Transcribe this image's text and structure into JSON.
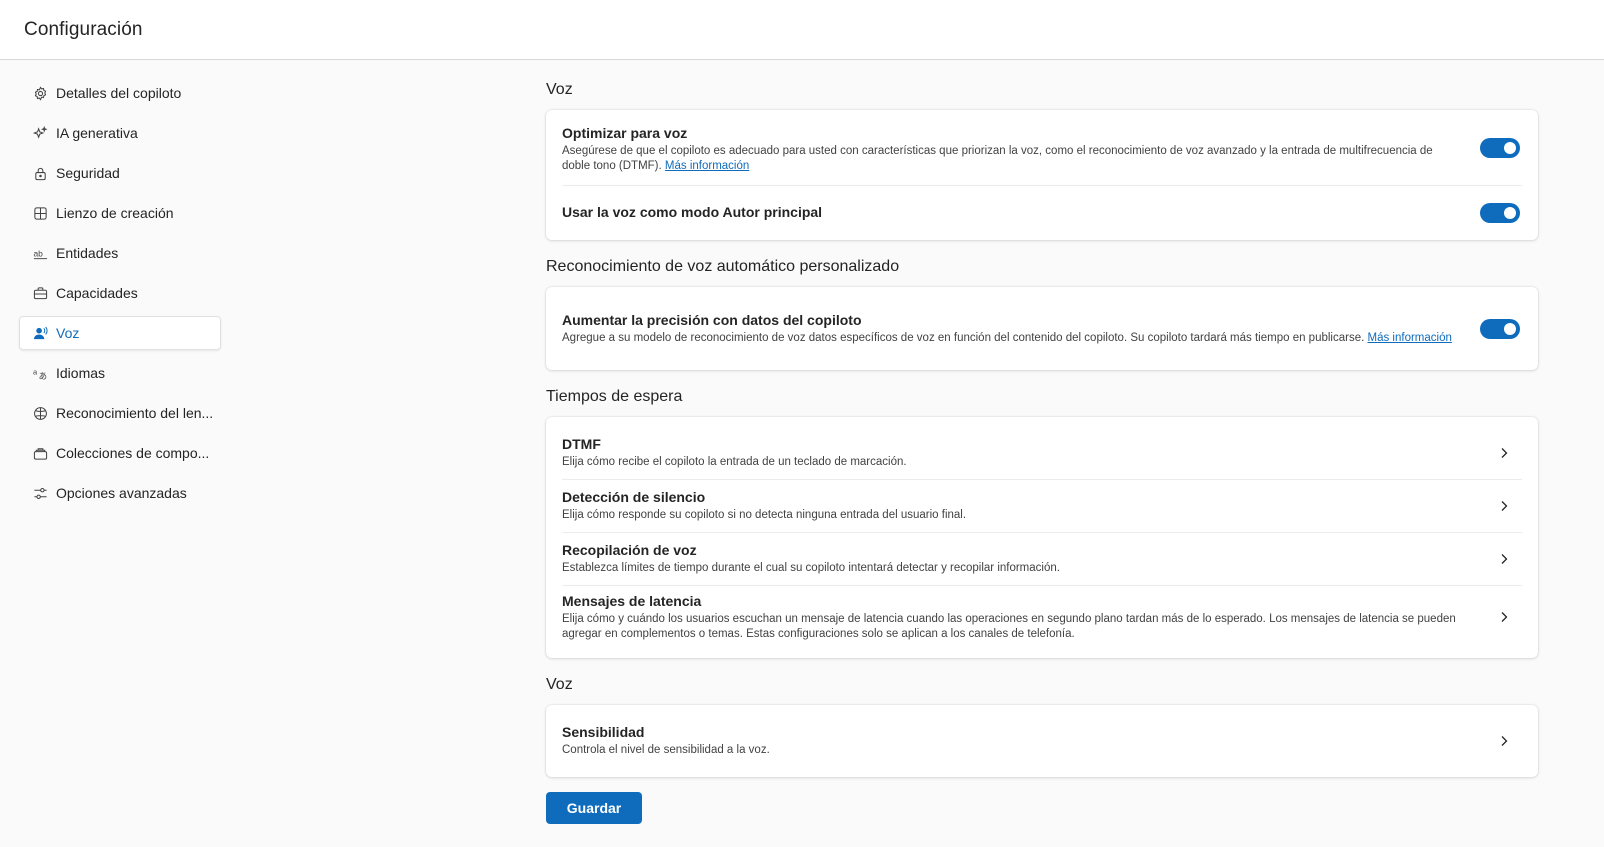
{
  "header": {
    "title": "Configuración"
  },
  "sidebar": {
    "items": [
      {
        "label": "Detalles del copiloto",
        "icon": "gear-icon"
      },
      {
        "label": "IA generativa",
        "icon": "sparkle-icon"
      },
      {
        "label": "Seguridad",
        "icon": "lock-icon"
      },
      {
        "label": "Lienzo de creación",
        "icon": "grid-icon"
      },
      {
        "label": "Entidades",
        "icon": "ab-icon"
      },
      {
        "label": "Capacidades",
        "icon": "briefcase-icon"
      },
      {
        "label": "Voz",
        "icon": "person-voice-icon",
        "active": true
      },
      {
        "label": "Idiomas",
        "icon": "translate-icon"
      },
      {
        "label": "Reconocimiento del len...",
        "icon": "brain-icon"
      },
      {
        "label": "Colecciones de compo...",
        "icon": "collection-icon"
      },
      {
        "label": "Opciones avanzadas",
        "icon": "sliders-icon"
      }
    ]
  },
  "sections": {
    "voz": {
      "title": "Voz",
      "optimize": {
        "title": "Optimizar para voz",
        "desc": "Asegúrese de que el copiloto es adecuado para usted con características que priorizan la voz, como el reconocimiento de voz avanzado y la entrada de multifrecuencia de doble tono (DTMF).",
        "link": "Más información",
        "enabled": true
      },
      "author_mode": {
        "title": "Usar la voz como modo Autor principal",
        "enabled": true
      }
    },
    "asr": {
      "title": "Reconocimiento de voz automático personalizado",
      "precision": {
        "title": "Aumentar la precisión con datos del copiloto",
        "desc": "Agregue a su modelo de reconocimiento de voz datos específicos de voz en función del contenido del copiloto. Su copiloto tardará más tiempo en publicarse.",
        "link": "Más información",
        "enabled": true
      }
    },
    "timeouts": {
      "title": "Tiempos de espera",
      "rows": [
        {
          "title": "DTMF",
          "desc": "Elija cómo recibe el copiloto la entrada de un teclado de marcación."
        },
        {
          "title": "Detección de silencio",
          "desc": "Elija cómo responde su copiloto si no detecta ninguna entrada del usuario final."
        },
        {
          "title": "Recopilación de voz",
          "desc": "Establezca límites de tiempo durante el cual su copiloto intentará detectar y recopilar información."
        },
        {
          "title": "Mensajes de latencia",
          "desc": "Elija cómo y cuándo los usuarios escuchan un mensaje de latencia cuando las operaciones en segundo plano tardan más de lo esperado. Los mensajes de latencia se pueden agregar en complementos o temas. Estas configuraciones solo se aplican a los canales de telefonía."
        }
      ]
    },
    "voz2": {
      "title": "Voz",
      "sensitivity": {
        "title": "Sensibilidad",
        "desc": "Controla el nivel de sensibilidad a la voz."
      }
    }
  },
  "actions": {
    "save_label": "Guardar"
  },
  "colors": {
    "accent": "#0f6cbd",
    "background": "#fafafa",
    "card": "#ffffff"
  }
}
